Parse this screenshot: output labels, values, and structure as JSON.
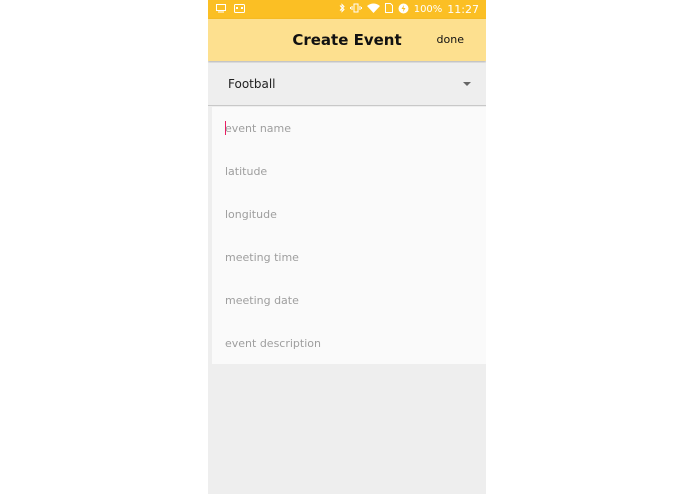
{
  "status_bar": {
    "battery": "100%",
    "time": "11:27"
  },
  "app_bar": {
    "title": "Create Event",
    "done_label": "done"
  },
  "category_dropdown": {
    "selected": "Football"
  },
  "form": {
    "fields": [
      {
        "placeholder": "event name",
        "value": ""
      },
      {
        "placeholder": "latitude",
        "value": ""
      },
      {
        "placeholder": "longitude",
        "value": ""
      },
      {
        "placeholder": "meeting time",
        "value": ""
      },
      {
        "placeholder": "meeting date",
        "value": ""
      },
      {
        "placeholder": "event description",
        "value": ""
      }
    ]
  }
}
